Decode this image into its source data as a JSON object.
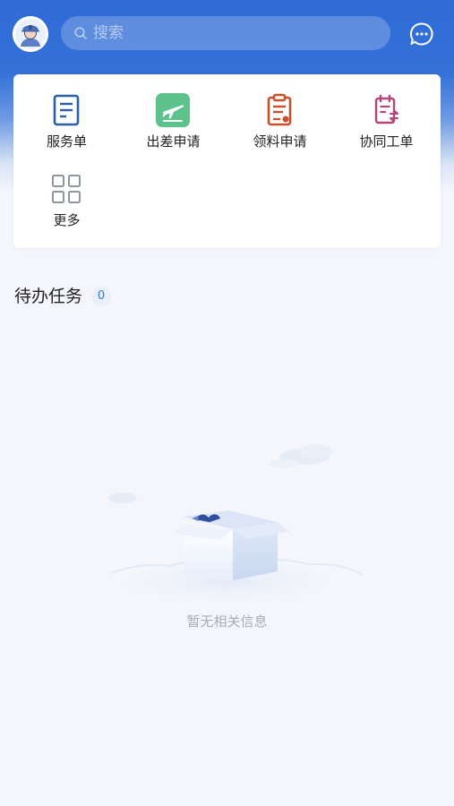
{
  "header": {
    "avatar_icon": "worker-avatar-icon",
    "search_placeholder": "搜索",
    "message_icon": "chat-bubble-icon"
  },
  "quick_actions": [
    {
      "label": "服务单",
      "icon": "service-order-icon"
    },
    {
      "label": "出差申请",
      "icon": "plane-takeoff-icon"
    },
    {
      "label": "领料申请",
      "icon": "clipboard-icon"
    },
    {
      "label": "协同工单",
      "icon": "collab-order-icon"
    },
    {
      "label": "更多",
      "icon": "grid-more-icon"
    }
  ],
  "pending": {
    "title": "待办任务",
    "count": "0"
  },
  "empty_state": {
    "text": "暂无相关信息"
  },
  "colors": {
    "primary": "#3471d8",
    "card_bg": "#ffffff",
    "page_bg": "#f4f6fb"
  }
}
